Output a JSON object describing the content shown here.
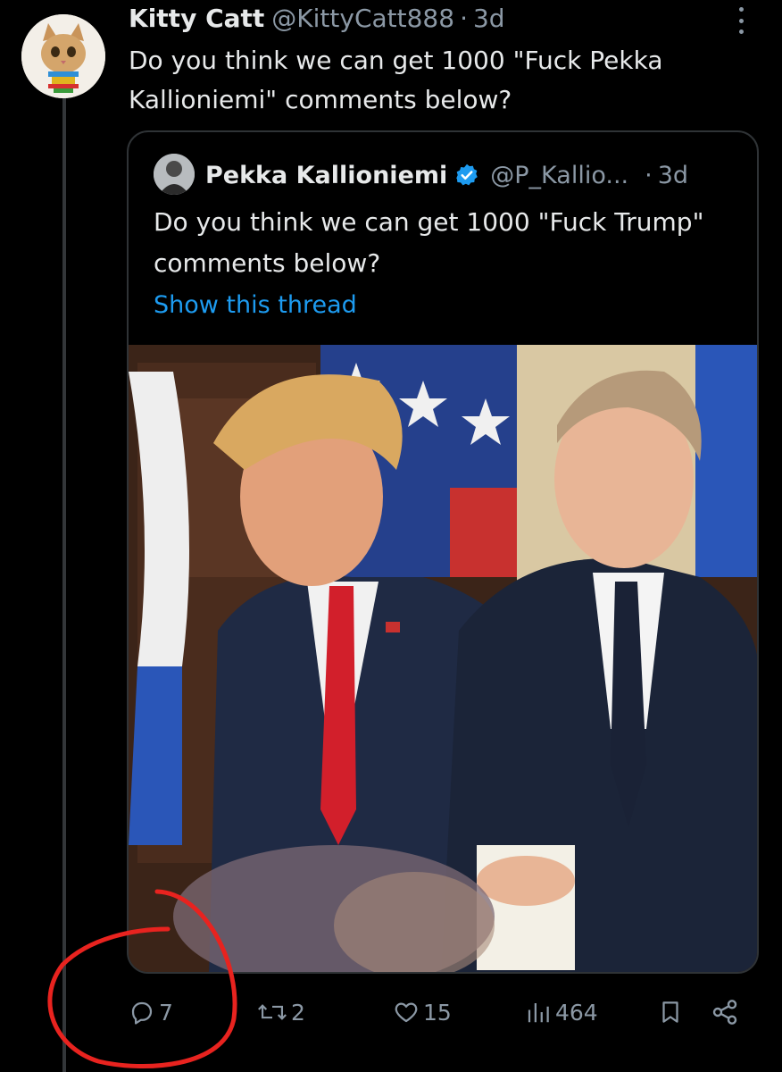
{
  "tweet": {
    "display_name": "Kitty Catt",
    "handle": "@KittyCatt888",
    "separator": "·",
    "time": "3d",
    "text": "Do you think we can get 1000 \"Fuck Pekka Kallioniemi\" comments below?"
  },
  "quoted_tweet": {
    "display_name": "Pekka Kallioniemi",
    "handle": "@P_Kallio...",
    "separator": "·",
    "time": "3d",
    "text": "Do you think we can get 1000 \"Fuck Trump\" comments below?",
    "show_thread_label": "Show this thread"
  },
  "actions": {
    "replies": "7",
    "reposts": "2",
    "likes": "15",
    "views": "464"
  },
  "icons": {
    "more": "more-vertical-icon",
    "verified": "verified-badge-icon",
    "reply": "reply-icon",
    "repost": "repost-icon",
    "like": "heart-icon",
    "views": "views-icon",
    "bookmark": "bookmark-icon",
    "share": "share-icon"
  },
  "colors": {
    "background": "#000000",
    "text": "#e7e9ea",
    "secondary": "#8b98a5",
    "link": "#1d9bf0",
    "annotation": "#e8231f"
  }
}
